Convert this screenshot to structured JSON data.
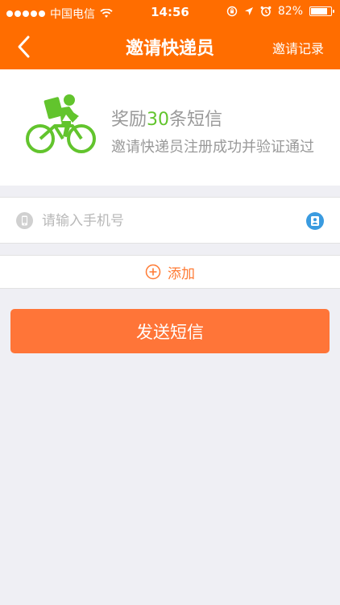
{
  "status_bar": {
    "carrier": "中国电信",
    "time": "14:56",
    "battery": "82%",
    "battery_level": 0.82
  },
  "navbar": {
    "title": "邀请快递员",
    "right_action": "邀请记录",
    "back_icon": "chevron-left-icon"
  },
  "reward": {
    "title_prefix": "奖励",
    "title_number": "30",
    "title_suffix": "条短信",
    "subtitle": "邀请快递员注册成功并验证通过",
    "icon": "courier-bike-icon"
  },
  "phone_field": {
    "placeholder": "请输入手机号",
    "value": "",
    "leading_icon": "phone-icon",
    "trailing_icon": "contacts-icon"
  },
  "add_row": {
    "label": "添加",
    "icon": "plus-circle-icon"
  },
  "send_button": {
    "label": "发送短信"
  },
  "colors": {
    "brand_orange": "#ff6d00",
    "button_orange": "#ff7538",
    "accent_green": "#62c42d",
    "contact_blue": "#3a9be0",
    "background": "#efeff4"
  }
}
